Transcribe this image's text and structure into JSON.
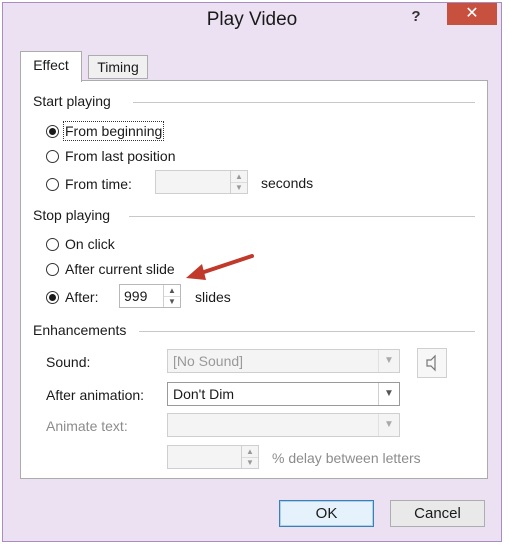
{
  "window": {
    "title": "Play Video",
    "help_label": "?",
    "close_label": "✕"
  },
  "tabs": [
    {
      "label": "Effect",
      "active": true
    },
    {
      "label": "Timing",
      "active": false
    }
  ],
  "start_playing": {
    "heading": "Start playing",
    "options": [
      {
        "label": "From beginning",
        "checked": true
      },
      {
        "label": "From last position",
        "checked": false
      },
      {
        "label": "From time:",
        "checked": false
      }
    ],
    "time_value": "",
    "seconds_label": "seconds"
  },
  "stop_playing": {
    "heading": "Stop playing",
    "options": [
      {
        "label": "On click",
        "checked": false
      },
      {
        "label": "After current slide",
        "checked": false
      },
      {
        "label": "After:",
        "checked": true
      }
    ],
    "after_value": "999",
    "slides_label": "slides"
  },
  "enhancements": {
    "heading": "Enhancements",
    "sound_label": "Sound:",
    "sound_value": "[No Sound]",
    "after_animation_label": "After animation:",
    "after_animation_value": "Don't Dim",
    "animate_text_label": "Animate text:",
    "animate_text_value": "",
    "delay_value": "",
    "delay_label": "% delay between letters"
  },
  "buttons": {
    "ok": "OK",
    "cancel": "Cancel"
  },
  "colors": {
    "close_button": "#c7503f",
    "window_frame": "#ece1f2",
    "annotation_arrow": "#c0392b"
  },
  "icons": {
    "speaker": "speaker-icon",
    "annotation": "red-arrow-icon"
  }
}
